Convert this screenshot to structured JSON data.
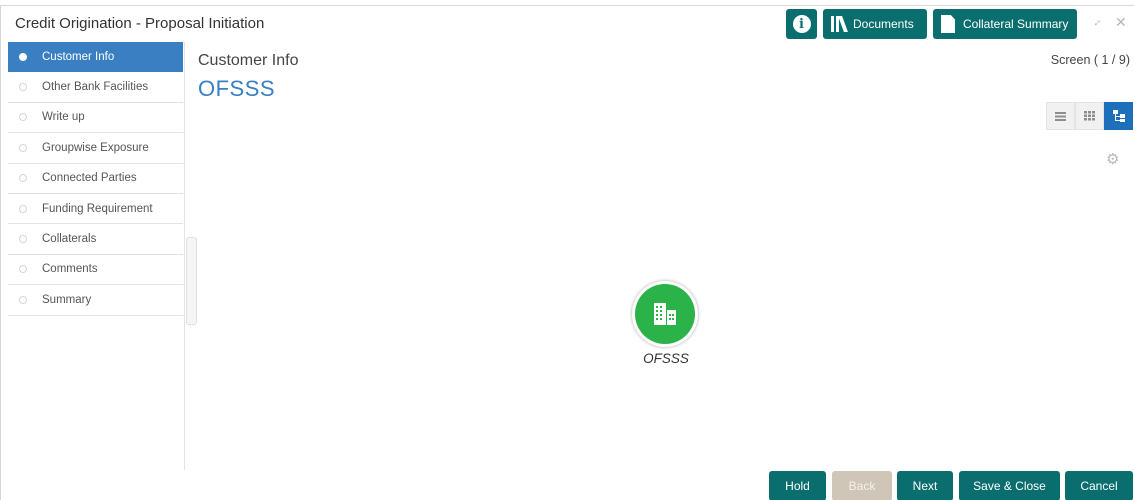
{
  "header": {
    "title": "Credit Origination - Proposal Initiation",
    "info_label": "i",
    "documents_label": "Documents",
    "collateral_summary_label": "Collateral Summary"
  },
  "sidebar": {
    "items": [
      {
        "label": "Customer Info",
        "active": true
      },
      {
        "label": "Other Bank Facilities",
        "active": false
      },
      {
        "label": "Write up",
        "active": false
      },
      {
        "label": "Groupwise Exposure",
        "active": false
      },
      {
        "label": "Connected Parties",
        "active": false
      },
      {
        "label": "Funding Requirement",
        "active": false
      },
      {
        "label": "Collaterals",
        "active": false
      },
      {
        "label": "Comments",
        "active": false
      },
      {
        "label": "Summary",
        "active": false
      }
    ]
  },
  "main": {
    "title": "Customer Info",
    "screen_counter": "Screen ( 1 / 9)",
    "entity_name": "OFSSS",
    "view_modes": [
      "list-icon",
      "grid-icon",
      "hierarchy-icon"
    ],
    "active_view": "hierarchy-icon",
    "org_node_label": "OFSSS"
  },
  "footer": {
    "hold_label": "Hold",
    "back_label": "Back",
    "next_label": "Next",
    "save_close_label": "Save & Close",
    "cancel_label": "Cancel"
  },
  "colors": {
    "primary_button": "#0b6e6e",
    "active_nav": "#3a7fc1",
    "entity_title": "#3a7fc1",
    "org_node": "#2bb34a",
    "disabled_button": "#cfc6b8"
  }
}
